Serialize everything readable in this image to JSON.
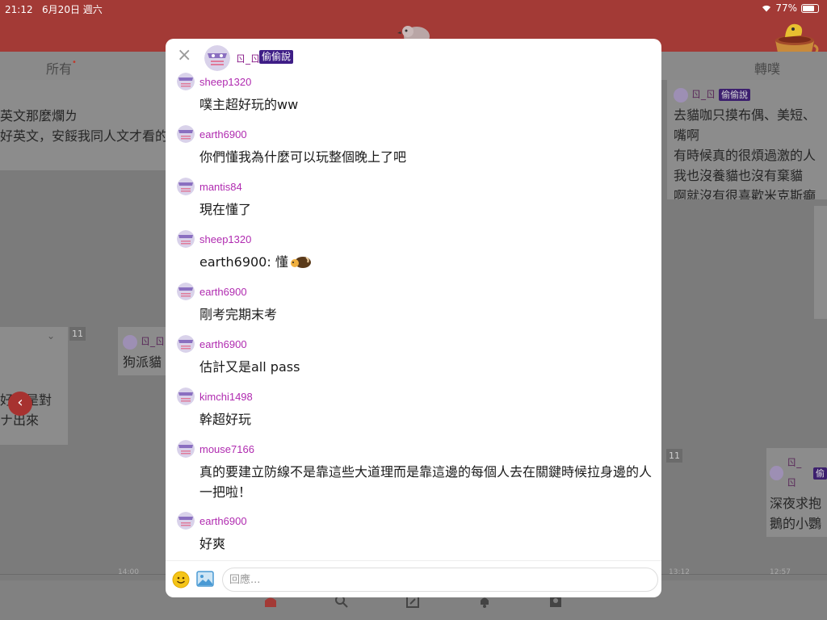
{
  "status_bar": {
    "time": "21:12",
    "date": "6月20日 週六",
    "battery": "77%"
  },
  "tabs": {
    "all_label": "所有",
    "all_dot": "•",
    "replurk_label": "轉噗"
  },
  "background": {
    "card1_lines": [
      "英文那麼爛ㄌ",
      "好英文，安餒我同人文才看的"
    ],
    "card2_user": "ㄖ_ㄖ",
    "card2_badge": "偷偷說",
    "card2_lines": [
      "去貓咖只摸布偶、美短、",
      "嘴啊",
      "有時候真的很煩過激的人",
      "我也沒養貓也沒有棄貓",
      "啊就沒有很喜歡米克斯癲"
    ],
    "card3_lines": [
      "好？是對",
      "ナ出來"
    ],
    "card4_user": "ㄖ_ㄖ",
    "card4_text": "狗派貓",
    "card5_user": "ㄖ_ㄖ",
    "card5_badge": "偷",
    "card5_lines": [
      "深夜求抱",
      "鵝的小鸚"
    ],
    "count1": "11",
    "count2": "11",
    "timeline_times": [
      "14:00",
      "13:12",
      "12:57"
    ]
  },
  "modal": {
    "header": {
      "user": "ㄖ_ㄖ",
      "badge": "偷偷說",
      "close_glyph": "×"
    },
    "responses": [
      {
        "user": "sheep1320",
        "text": "噗主超好玩的ww"
      },
      {
        "user": "earth6900",
        "text": "你們懂我為什麼可以玩整個晚上了吧"
      },
      {
        "user": "mantis84",
        "text": "現在懂了"
      },
      {
        "user": "sheep1320",
        "text": "earth6900: 懂"
      },
      {
        "user": "earth6900",
        "text": "剛考完期末考"
      },
      {
        "user": "earth6900",
        "text": "估計又是all pass"
      },
      {
        "user": "kimchi1498",
        "text": "幹超好玩"
      },
      {
        "user": "mouse7166",
        "text": "真的要建立防線不是靠這些大道理而是靠這邊的每個人去在關鍵時候拉身邊的人一把啦！"
      },
      {
        "user": "earth6900",
        "text": "好爽"
      }
    ],
    "footer": {
      "placeholder": "回應..."
    }
  },
  "colors": {
    "brand": "#a33a36",
    "username": "#b02bb0",
    "badge": "#3e1d86"
  },
  "icons": [
    "close-icon",
    "emoji-icon",
    "image-icon",
    "back-arrow-icon",
    "bird-logo-icon",
    "home-icon",
    "search-icon",
    "compose-icon",
    "bell-icon",
    "profile-icon"
  ]
}
